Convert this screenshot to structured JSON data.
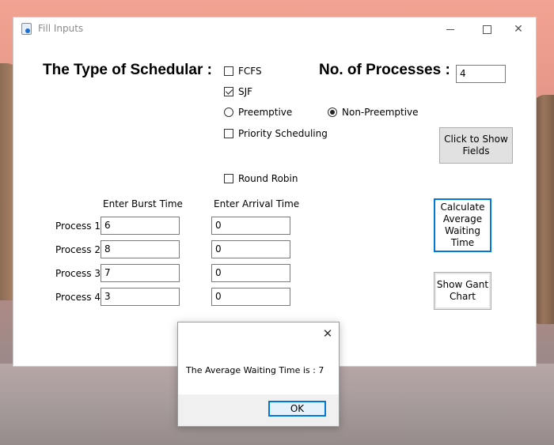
{
  "window": {
    "title": "Fill Inputs",
    "controls": {
      "minimize": "minimize-icon",
      "maximize": "maximize-icon",
      "close": "close-icon"
    }
  },
  "scheduler": {
    "heading": "The Type of Schedular :",
    "options": {
      "fcfs": {
        "label": "FCFS",
        "checked": false
      },
      "sjf": {
        "label": "SJF",
        "checked": true
      },
      "preemptive": {
        "label": "Preemptive",
        "selected": false
      },
      "non_preemptive": {
        "label": "Non-Preemptive",
        "selected": true
      },
      "priority": {
        "label": "Priority Scheduling",
        "checked": false
      },
      "round_robin": {
        "label": "Round Robin",
        "checked": false
      }
    }
  },
  "processes_count": {
    "label": "No. of Processes :",
    "value": "4"
  },
  "buttons": {
    "show_fields": "Click to Show Fields",
    "calc_avg": "Calculate Average Waiting Time",
    "gantt": "Show Gant Chart"
  },
  "table": {
    "burst_header": "Enter Burst Time",
    "arrival_header": "Enter Arrival Time",
    "rows": [
      {
        "label": "Process 1",
        "burst": "6",
        "arrival": "0"
      },
      {
        "label": "Process 2",
        "burst": "8",
        "arrival": "0"
      },
      {
        "label": "Process 3",
        "burst": "7",
        "arrival": "0"
      },
      {
        "label": "Process 4",
        "burst": "3",
        "arrival": "0"
      }
    ]
  },
  "dialog": {
    "message": "The Average Waiting Time is : 7",
    "ok": "OK"
  },
  "colors": {
    "accent": "#0078d7",
    "button_face": "#e1e1e1"
  }
}
